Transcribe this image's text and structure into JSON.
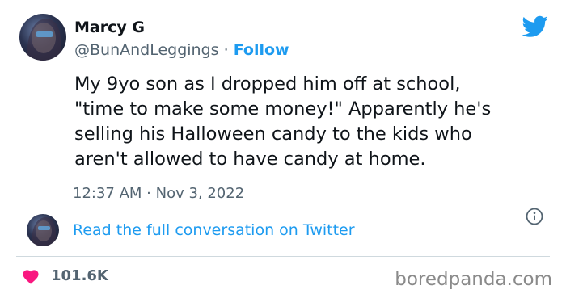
{
  "tweet": {
    "author_name": "Marcy G",
    "handle": "@BunAndLeggings",
    "separator": " · ",
    "follow_label": "Follow",
    "text_lines": [
      "My 9yo son as I dropped him off at school,",
      "\"time to make some money!\" Apparently he's",
      "selling his Halloween candy to the kids who",
      "aren't allowed to have candy at home."
    ],
    "timestamp": "12:37 AM · Nov 3, 2022",
    "read_more_label": "Read the full conversation on Twitter",
    "like_count": "101.6K"
  },
  "watermark": "boredpanda.com",
  "icons": {
    "brand": "twitter-bird-icon",
    "info": "info-icon",
    "like": "heart-icon"
  },
  "colors": {
    "accent": "#1d9bf0",
    "text": "#0f1419",
    "muted": "#536471",
    "heart": "#f91880",
    "divider": "#cfd9de",
    "watermark": "#8a8a8a"
  }
}
